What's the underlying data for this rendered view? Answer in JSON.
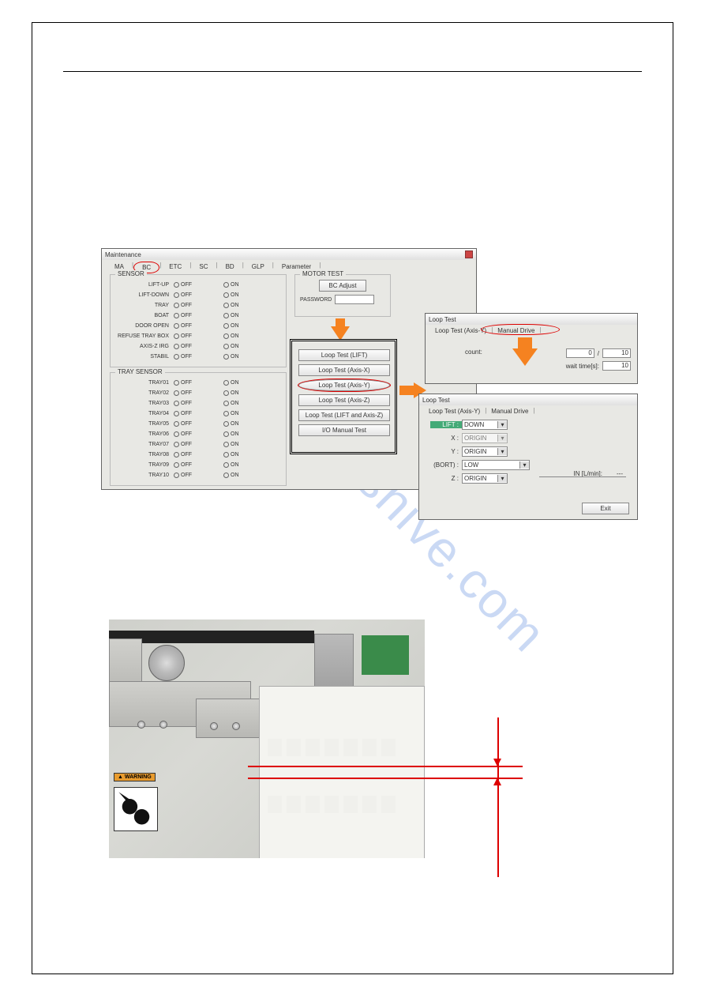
{
  "main_window": {
    "title": "Maintenance",
    "tabs": [
      "MA",
      "BC",
      "ETC",
      "SC",
      "BD",
      "GLP",
      "Parameter"
    ],
    "active_tab": "BC",
    "sensor_group_label": "SENSOR",
    "sensor_items": [
      {
        "name": "LIFT-UP",
        "state": "OFF"
      },
      {
        "name": "LIFT-DOWN",
        "state": "OFF"
      },
      {
        "name": "TRAY",
        "state": "OFF"
      },
      {
        "name": "BOAT",
        "state": "OFF"
      },
      {
        "name": "DOOR OPEN",
        "state": "OFF"
      },
      {
        "name": "REFUSE TRAY BOX",
        "state": "OFF"
      },
      {
        "name": "AXIS-Z IRG",
        "state": "OFF"
      },
      {
        "name": "STABIL",
        "state": "OFF"
      }
    ],
    "radio_labels": {
      "off": "OFF",
      "on": "ON"
    },
    "tray_sensor_label": "TRAY SENSOR",
    "tray_items": [
      {
        "name": "TRAY01",
        "state": "OFF"
      },
      {
        "name": "TRAY02",
        "state": "OFF"
      },
      {
        "name": "TRAY03",
        "state": "OFF"
      },
      {
        "name": "TRAY04",
        "state": "OFF"
      },
      {
        "name": "TRAY05",
        "state": "OFF"
      },
      {
        "name": "TRAY06",
        "state": "OFF"
      },
      {
        "name": "TRAY07",
        "state": "OFF"
      },
      {
        "name": "TRAY08",
        "state": "OFF"
      },
      {
        "name": "TRAY09",
        "state": "OFF"
      },
      {
        "name": "TRAY10",
        "state": "OFF"
      }
    ],
    "motor_test_label": "MOTOR TEST",
    "bc_adjust_btn": "BC Adjust",
    "password_label": "PASSWORD",
    "loop_buttons": [
      "Loop Test (LIFT)",
      "Loop Test (Axis-X)",
      "Loop Test (Axis-Y)",
      "Loop Test (Axis-Z)",
      "Loop Test (LIFT and Axis-Z)",
      "I/O Manual Test"
    ]
  },
  "loop_window1": {
    "title": "Loop Test",
    "tabs": [
      "Loop Test (Axis-Y)",
      "Manual Drive"
    ],
    "count_label": "count:",
    "count_value": "0",
    "count_sep": "/",
    "count_max": "10",
    "wait_label": "wait time[s]:",
    "wait_value": "10"
  },
  "loop_window2": {
    "title": "Loop Test",
    "tabs": [
      "Loop Test (Axis-Y)",
      "Manual Drive"
    ],
    "lift_label": "LIFT :",
    "lift_value": "DOWN",
    "x_label": "X :",
    "x_value": "ORIGIN",
    "y_label": "Y :",
    "y_value": "ORIGIN",
    "bort_label": "(BORT) :",
    "bort_value": "LOW",
    "z_label": "Z :",
    "z_value": "ORIGIN",
    "in_label": "IN [L/min]:",
    "in_value": "---",
    "exit_btn": "Exit"
  },
  "photo": {
    "warning_text": "WARNING"
  },
  "watermark": "manualshive.com"
}
